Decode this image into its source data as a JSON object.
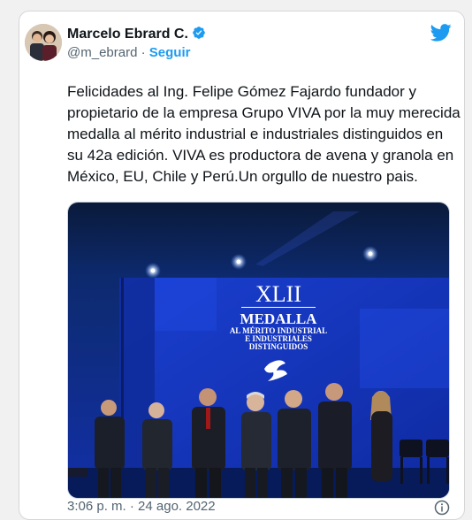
{
  "author": {
    "name": "Marcelo Ebrard C.",
    "handle": "@m_ebrard",
    "separator": "·",
    "follow_label": "Seguir"
  },
  "icons": {
    "verified": "verified-badge-icon",
    "brand": "twitter-bird-icon",
    "info": "info-icon"
  },
  "colors": {
    "accent": "#1d9bf0",
    "text": "#0f1419",
    "muted": "#536471"
  },
  "tweet": {
    "text": "Felicidades al Ing. Felipe Gómez Fajardo fundador y propietario de la empresa Grupo VIVA por la muy merecida medalla al mérito industrial e industriales distinguidos en su 42a edición. VIVA es productora de avena y granola en México, EU, Chile y Perú.Un orgullo de nuestro pais.",
    "timestamp": "3:06 p. m. · 24 ago. 2022"
  },
  "media": {
    "screen_lines": [
      "XLII",
      "MEDALLA",
      "AL MÉRITO INDUSTRIAL",
      "E INDUSTRIALES",
      "DISTINGUIDOS"
    ]
  }
}
